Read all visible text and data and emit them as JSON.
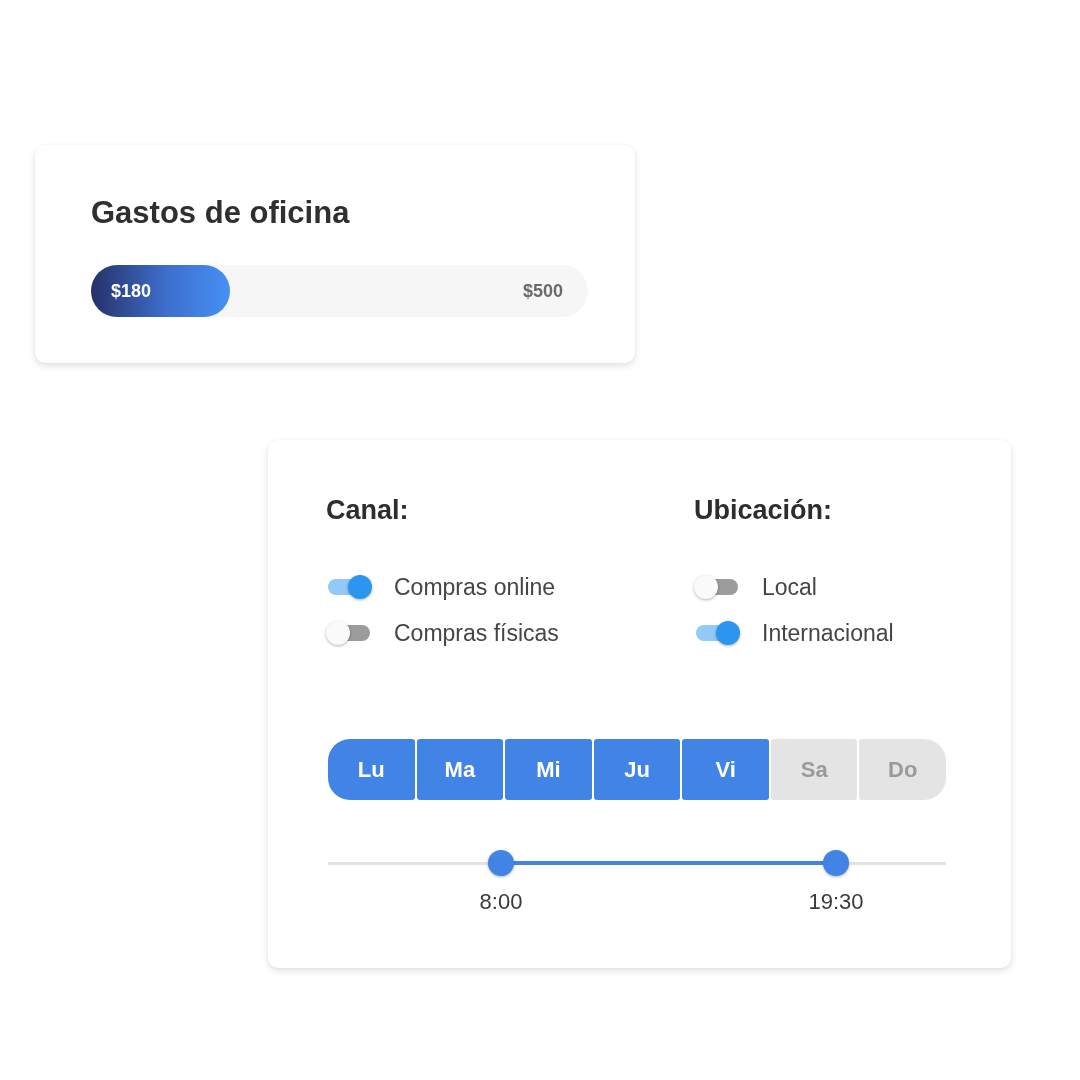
{
  "expense": {
    "title": "Gastos de oficina",
    "spent": "$180",
    "budget": "$500",
    "level": 0.28
  },
  "filters": {
    "groups": [
      {
        "heading": "Canal:",
        "options": [
          {
            "label": "Compras online",
            "on": true
          },
          {
            "label": "Compras físicas",
            "on": false
          }
        ]
      },
      {
        "heading": "Ubicación:",
        "options": [
          {
            "label": "Local",
            "on": false
          },
          {
            "label": "Internacional",
            "on": true
          }
        ]
      }
    ],
    "days": [
      {
        "label": "Lu",
        "selected": true
      },
      {
        "label": "Ma",
        "selected": true
      },
      {
        "label": "Mi",
        "selected": true
      },
      {
        "label": "Ju",
        "selected": true
      },
      {
        "label": "Vi",
        "selected": true
      },
      {
        "label": "Sa",
        "selected": false
      },
      {
        "label": "Do",
        "selected": false
      }
    ],
    "schedule": {
      "thumbs": [
        {
          "level": 0.28,
          "label": "8:00"
        },
        {
          "level": 0.822,
          "label": "19:30"
        }
      ]
    }
  }
}
